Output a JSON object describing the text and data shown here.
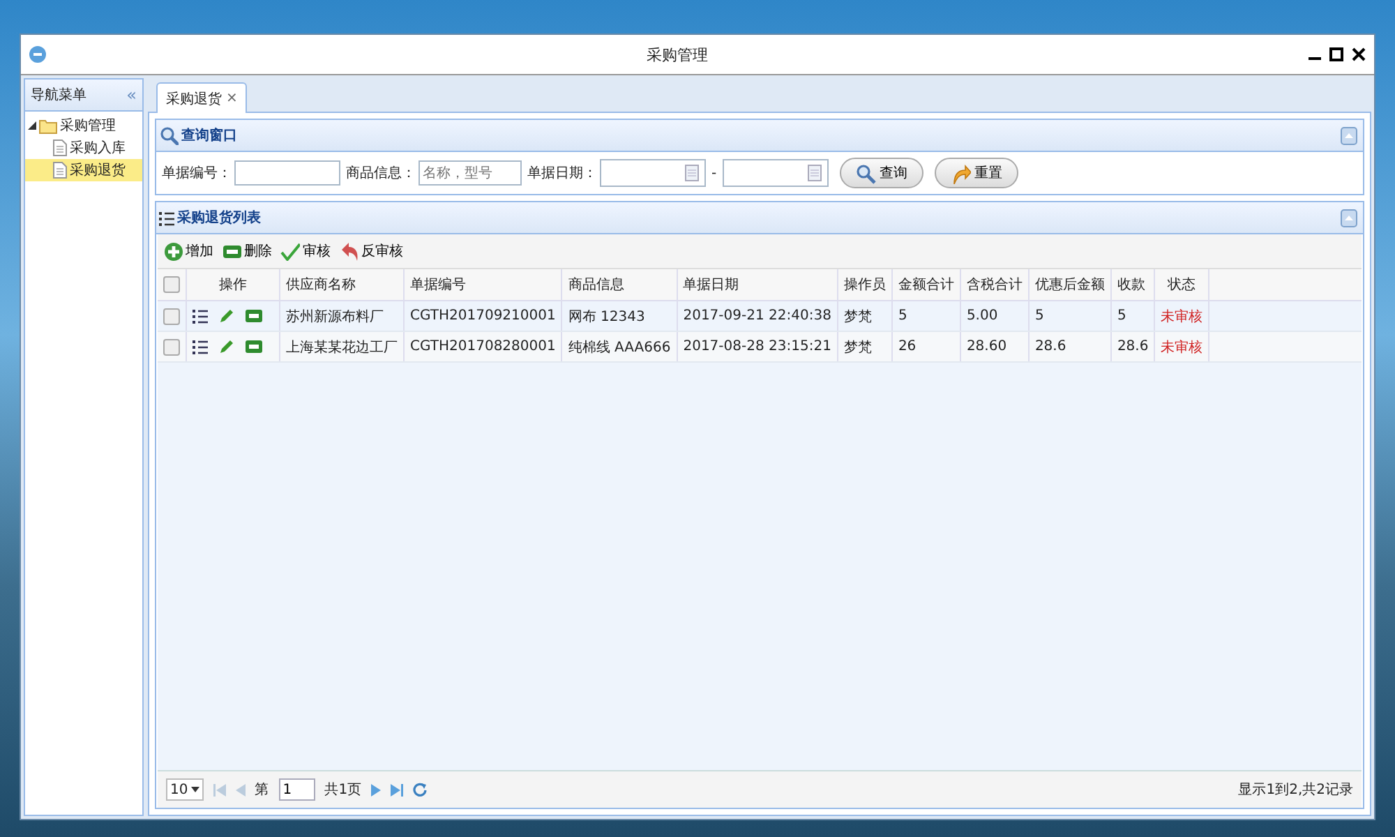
{
  "window": {
    "title": "采购管理"
  },
  "sidebar": {
    "title": "导航菜单",
    "collapse_glyph": "«",
    "tree": [
      {
        "label": "采购管理",
        "expanded": true,
        "selected": false,
        "children": [
          {
            "label": "采购入库",
            "selected": false
          },
          {
            "label": "采购退货",
            "selected": true
          }
        ]
      }
    ]
  },
  "tabs": [
    {
      "label": "采购退货",
      "close": "×",
      "selected": true
    }
  ],
  "query_panel": {
    "title": "查询窗口",
    "fields": [
      {
        "kind": "text",
        "label": "单据编号："
      },
      {
        "kind": "text",
        "label": "商品信息：",
        "placeholder": "名称，型号"
      },
      {
        "kind": "daterange",
        "label": "单据日期：",
        "separator": "-"
      }
    ],
    "buttons": [
      {
        "kind": "search",
        "label": "查询"
      },
      {
        "kind": "reset",
        "label": "重置"
      }
    ]
  },
  "list_panel": {
    "title": "采购退货列表",
    "toolbar": [
      {
        "kind": "add",
        "label": "增加"
      },
      {
        "kind": "delete",
        "label": "删除"
      },
      {
        "kind": "approve",
        "label": "审核"
      },
      {
        "kind": "unapprove",
        "label": "反审核"
      }
    ],
    "table": {
      "all_checked": false,
      "columns": [
        "操作",
        "供应商名称",
        "单据编号",
        "商品信息",
        "单据日期",
        "操作员",
        "金额合计",
        "含税合计",
        "优惠后金额",
        "收款",
        "状态"
      ],
      "rows": [
        {
          "checked": false,
          "cells": [
            "",
            "苏州新源布料厂",
            "CGTH201709210001",
            "网布 12343",
            "2017-09-21 22:40:38",
            "梦梵",
            "5",
            "5.00",
            "5",
            "5",
            "未审核"
          ]
        },
        {
          "checked": false,
          "cells": [
            "",
            "上海某某花边工厂",
            "CGTH201708280001",
            "纯棉线 AAA666",
            "2017-08-28 23:15:21",
            "梦梵",
            "26",
            "28.60",
            "28.6",
            "28.6",
            "未审核"
          ]
        }
      ]
    },
    "pagination": {
      "page_size": "10",
      "page_prefix": "第",
      "page": "1",
      "page_suffix": "共1页",
      "summary": "显示1到2,共2记录"
    }
  }
}
